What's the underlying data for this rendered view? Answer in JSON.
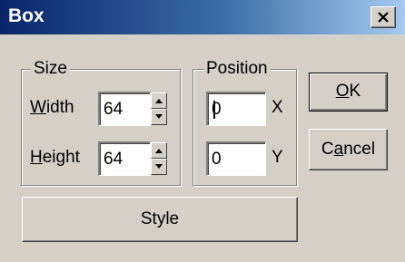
{
  "window": {
    "title": "Box"
  },
  "size_group": {
    "legend": "Size",
    "width": {
      "label_mnemonic": "W",
      "label_rest": "idth",
      "value": "64"
    },
    "height": {
      "label_mnemonic": "H",
      "label_rest": "eight",
      "value": "64"
    }
  },
  "position_group": {
    "legend": "Position",
    "x": {
      "value": "0",
      "axis_label": "X"
    },
    "y": {
      "value": "0",
      "axis_label": "Y"
    }
  },
  "buttons": {
    "ok": {
      "mnemonic": "O",
      "rest": "K"
    },
    "cancel": {
      "before": "C",
      "mnemonic": "a",
      "rest": "ncel"
    },
    "style": "Style"
  },
  "colors": {
    "face": "#d4d0c8",
    "title_start": "#0a246a",
    "title_end": "#a6caf0",
    "title_text": "#ffffff"
  }
}
